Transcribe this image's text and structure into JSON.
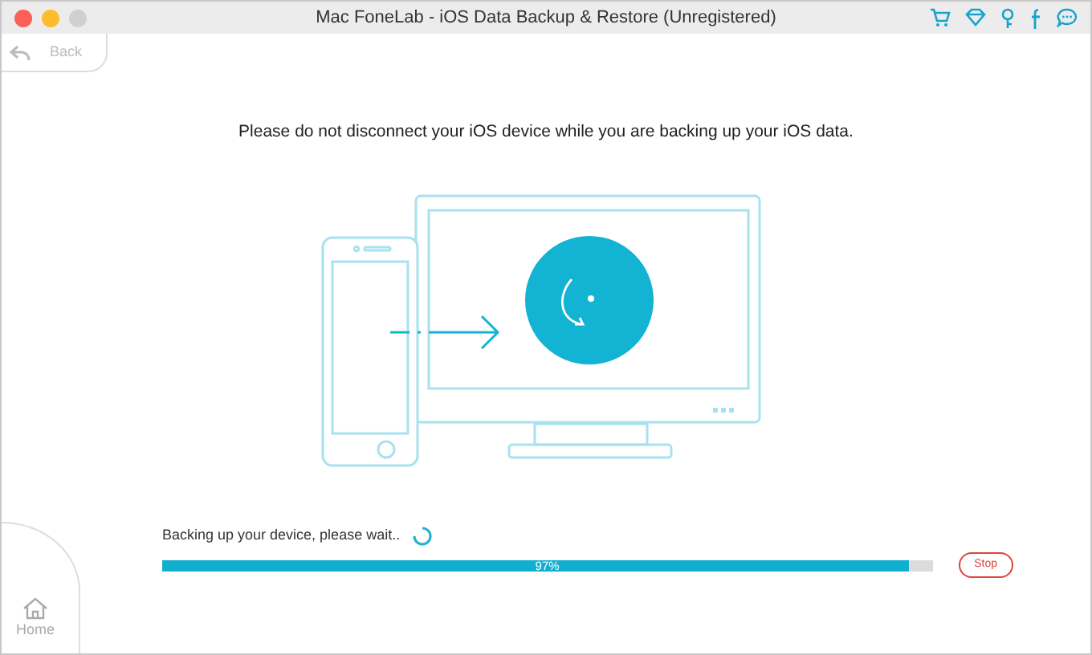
{
  "window": {
    "title": "Mac FoneLab - iOS Data Backup & Restore (Unregistered)"
  },
  "back": {
    "label": "Back",
    "disabled": true
  },
  "message": "Please do not disconnect your iOS device while you are backing up your iOS data.",
  "progress": {
    "label": "Backing up your device, please wait..",
    "level": 0.97,
    "reading": "97%"
  },
  "stop_button": "Stop",
  "home": {
    "label": "Home"
  }
}
